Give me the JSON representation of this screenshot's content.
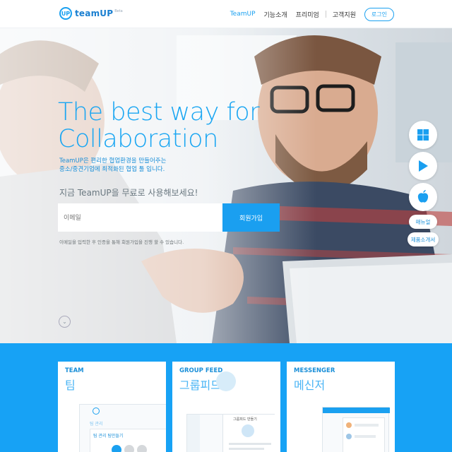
{
  "header": {
    "logo_mark": "UP",
    "logo_text": "teamUP",
    "logo_badge": "Beta",
    "nav": [
      "TeamUP",
      "기능소개",
      "프리미엄",
      "고객지원"
    ],
    "login_label": "로그인"
  },
  "hero": {
    "headline_line1": "The best way for",
    "headline_line2": "Collaboration",
    "sub_line1": "TeamUP은 편리한 협업환경을 만들어주는",
    "sub_line2": "중소/중견기업에 최적화된 협업 툴 입니다.",
    "prompt": "지금 TeamUP을 무료로 사용해보세요!",
    "email_placeholder": "이메일",
    "signup_label": "회원가입",
    "notice": "이메일을 입력한 후 인증을 통해 회원가입을 진행 할 수 있습니다."
  },
  "side": {
    "manual_label": "매뉴얼",
    "product_label": "제품소개서",
    "icons": [
      "windows-icon",
      "google-play-icon",
      "apple-icon"
    ]
  },
  "features": [
    {
      "en": "TEAM",
      "ko": "팀",
      "shot_label_1": "팀 관리",
      "shot_label_2": "팀 관리  팀만들기"
    },
    {
      "en": "GROUP FEED",
      "ko": "그룹피드",
      "shot_label_1": "그룹피드 만들기"
    },
    {
      "en": "MESSENGER",
      "ko": "메신저"
    }
  ],
  "colors": {
    "accent": "#1aa0f0",
    "section_bg": "#17a2f5"
  }
}
